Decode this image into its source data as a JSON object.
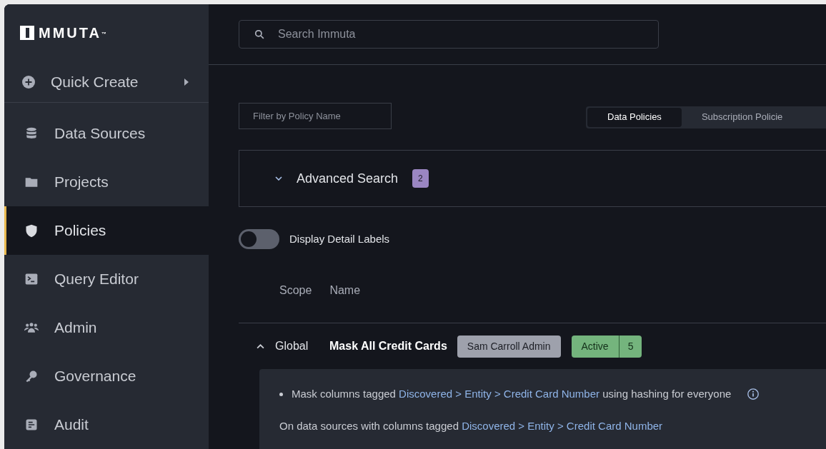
{
  "logo": {
    "text": "MMUTA",
    "mark": "™"
  },
  "quick_create": {
    "label": "Quick Create"
  },
  "sidebar": {
    "items": [
      {
        "label": "Data Sources",
        "kind": "database",
        "selected": false
      },
      {
        "label": "Projects",
        "kind": "folder",
        "selected": false
      },
      {
        "label": "Policies",
        "kind": "shield",
        "selected": true
      },
      {
        "label": "Query Editor",
        "kind": "terminal",
        "selected": false
      },
      {
        "label": "Admin",
        "kind": "users",
        "selected": false
      },
      {
        "label": "Governance",
        "kind": "key",
        "selected": false
      },
      {
        "label": "Audit",
        "kind": "document",
        "selected": false
      }
    ]
  },
  "search": {
    "placeholder": "Search Immuta"
  },
  "filter": {
    "placeholder": "Filter by Policy Name"
  },
  "tabs": [
    {
      "label": "Data Policies",
      "selected": true
    },
    {
      "label": "Subscription Policie",
      "selected": false
    }
  ],
  "advanced_search": {
    "label": "Advanced Search",
    "count": "2",
    "expanded": false
  },
  "detail_labels_toggle": {
    "label": "Display Detail Labels",
    "on": false
  },
  "table": {
    "columns": [
      "Scope",
      "Name"
    ],
    "rows": [
      {
        "expanded": true,
        "scope": "Global",
        "name": "Mask All Credit Cards",
        "author": "Sam Carroll Admin",
        "status": "Active",
        "count": "5",
        "rule": [
          {
            "kind": "plain",
            "text": "Mask columns tagged "
          },
          {
            "kind": "link",
            "text": "Discovered > Entity > Credit Card Number"
          },
          {
            "kind": "plain",
            "text": " using hashing for everyone"
          }
        ],
        "scope_text": [
          {
            "kind": "plain",
            "text": "On data sources with columns tagged "
          },
          {
            "kind": "link",
            "text": "Discovered > Entity > Credit Card Number"
          }
        ]
      }
    ]
  }
}
